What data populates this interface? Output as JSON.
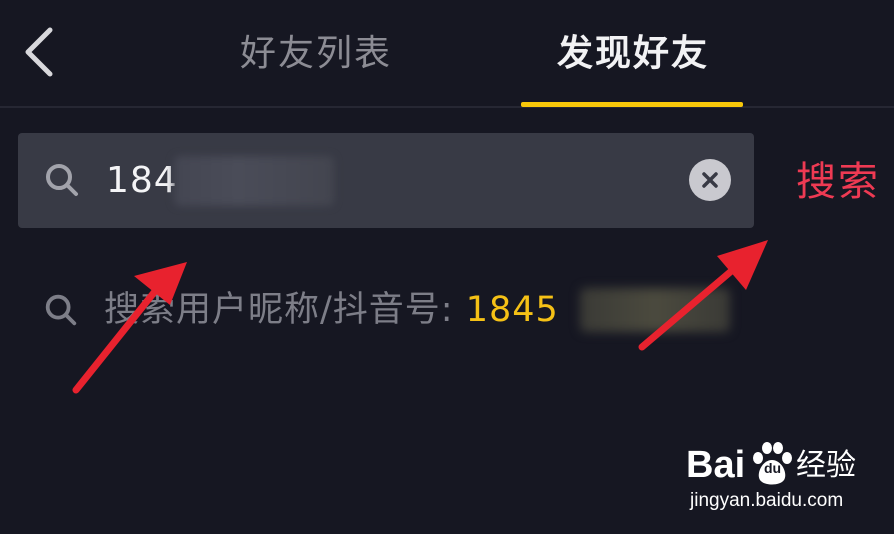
{
  "header": {
    "back_icon": "chevron-left-icon",
    "tabs": [
      {
        "label": "好友列表",
        "active": false
      },
      {
        "label": "发现好友",
        "active": true
      }
    ],
    "indicator_color": "#f8c80a"
  },
  "search": {
    "icon": "search-icon",
    "value": "184",
    "clear_icon": "close-circle-icon",
    "button_label": "搜索",
    "button_color": "#ee3a53"
  },
  "suggestion": {
    "icon": "search-icon",
    "prefix": "搜索用户昵称/抖音号: ",
    "query": "1845",
    "query_color": "#f5c116"
  },
  "annotations": {
    "arrow_color": "#e8222e"
  },
  "watermark": {
    "brand": "Bai",
    "brand_du": "du",
    "product": "经验",
    "url": "jingyan.baidu.com"
  }
}
